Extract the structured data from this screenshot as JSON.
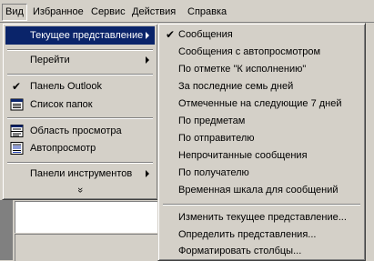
{
  "menubar": {
    "items": [
      {
        "label": "Вид",
        "active": true
      },
      {
        "label": "Избранное",
        "active": false
      },
      {
        "label": "Сервис",
        "active": false
      },
      {
        "label": "Действия",
        "active": false
      },
      {
        "label": "Справка",
        "active": false
      }
    ]
  },
  "view_menu": {
    "items": [
      {
        "label": "Текущее представление",
        "highlighted": true,
        "submenu": true
      },
      {
        "label": "Перейти",
        "submenu": true
      },
      {
        "label": "Панель Outlook",
        "checked": true
      },
      {
        "label": "Список папок",
        "icon": "folder-list-icon"
      },
      {
        "label": "Область просмотра",
        "icon": "preview-pane-icon"
      },
      {
        "label": "Автопросмотр",
        "icon": "autopreview-icon"
      },
      {
        "label": "Панели инструментов",
        "submenu": true
      }
    ],
    "expand_glyph": "»"
  },
  "current_view_menu": {
    "items": [
      {
        "label": "Сообщения",
        "checked": true
      },
      {
        "label": "Сообщения с автопросмотром"
      },
      {
        "label": "По отметке \"К исполнению\""
      },
      {
        "label": "За последние семь дней"
      },
      {
        "label": "Отмеченные на следующие 7 дней"
      },
      {
        "label": "По предметам"
      },
      {
        "label": "По отправителю"
      },
      {
        "label": "Непрочитанные сообщения"
      },
      {
        "label": "По получателю"
      },
      {
        "label": "Временная шкала для сообщений"
      }
    ],
    "actions": [
      {
        "label": "Изменить текущее представление..."
      },
      {
        "label": "Определить представления..."
      },
      {
        "label": "Форматировать столбцы..."
      }
    ]
  },
  "colors": {
    "highlight": "#0a246a",
    "face": "#d4d0c8"
  }
}
